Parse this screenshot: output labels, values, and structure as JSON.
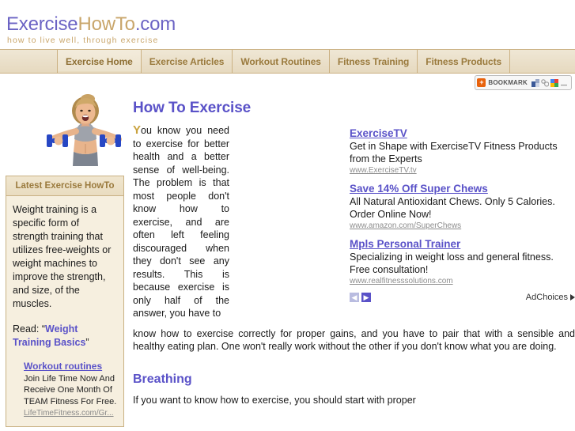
{
  "header": {
    "logo_part_a": "Exercise",
    "logo_part_b": "HowTo",
    "logo_part_c": ".com",
    "tagline": "how to live well, through exercise",
    "logo_color_a": "#6b63c4",
    "logo_color_b": "#c9a66b"
  },
  "nav": {
    "items": [
      {
        "label": "Exercise Home",
        "active": true
      },
      {
        "label": "Exercise Articles",
        "active": false
      },
      {
        "label": "Workout Routines",
        "active": false
      },
      {
        "label": "Fitness Training",
        "active": false
      },
      {
        "label": "Fitness Products",
        "active": false
      }
    ]
  },
  "bookmark": {
    "plus": "+",
    "label": "BOOKMARK"
  },
  "sidebar": {
    "box_title": "Latest Exercise HowTo",
    "box_text": "Weight training is a specific form of strength training that utilizes free-weights or weight machines to improve the strength, and size, of the muscles.",
    "read_prefix": "Read: “",
    "read_link": "Weight Training Basics",
    "read_suffix": "”",
    "ad": {
      "title": "Workout routines",
      "body": "Join Life Time Now And Receive One Month Of TEAM Fitness For Free.",
      "url": "LifeTimeFitness.com/Gr..."
    }
  },
  "main": {
    "heading": "How To Exercise",
    "dropcap": "Y",
    "intro_narrow": "ou know you need to exercise for better health and a better sense of well-being. The problem is that most people don't know how to exercise, and are often left feeling discouraged when they don't see any results. This is because exercise is only half of the answer, you have to",
    "intro_wide": "know how to exercise correctly for proper gains, and you have to pair that with a sensible and healthy eating plan. One won't really work without the other if you don't know what you are doing.",
    "heading2": "Breathing",
    "paragraph2": "If you want to know how to exercise, you should start with proper"
  },
  "ads": {
    "units": [
      {
        "title": "ExerciseTV",
        "body": "Get in Shape with ExerciseTV Fitness Products from the Experts",
        "url": "www.ExerciseTV.tv"
      },
      {
        "title": "Save 14% Off Super Chews",
        "body": "All Natural Antioxidant Chews. Only 5 Calories. Order Online Now!",
        "url": "www.amazon.com/SuperChews"
      },
      {
        "title": "Mpls Personal Trainer",
        "body": "Specializing in weight loss and general fitness. Free consultation!",
        "url": "www.realfitnesssolutions.com"
      }
    ],
    "prev_glyph": "◀",
    "next_glyph": "▶",
    "adchoices_label": "AdChoices"
  }
}
